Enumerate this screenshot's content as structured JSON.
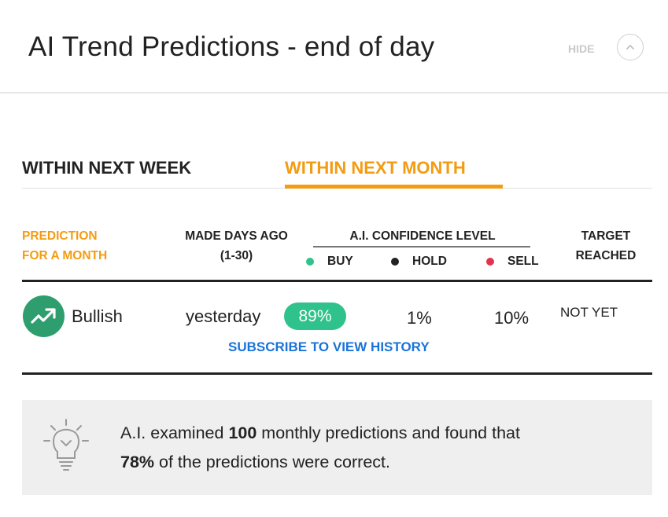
{
  "header": {
    "title": "AI Trend Predictions - end of day",
    "hide_label": "HIDE",
    "collapse_icon": "chevron-up-icon"
  },
  "tabs": [
    {
      "label": "WITHIN NEXT WEEK",
      "active": false
    },
    {
      "label": "WITHIN NEXT MONTH",
      "active": true
    }
  ],
  "table": {
    "headers": {
      "prediction_line1": "PREDICTION",
      "prediction_line2": "FOR A MONTH",
      "made_line1": "MADE DAYS AGO",
      "made_line2": "(1-30)",
      "confidence": "A.I. CONFIDENCE LEVEL",
      "target_line1": "TARGET",
      "target_line2": "REACHED"
    },
    "legend": [
      {
        "label": "BUY",
        "color": "#2fc28c"
      },
      {
        "label": "HOLD",
        "color": "#222222"
      },
      {
        "label": "SELL",
        "color": "#e0354e"
      }
    ],
    "row": {
      "prediction": "Bullish",
      "trend_icon": "trend-up-icon",
      "made": "yesterday",
      "buy": "89%",
      "hold": "1%",
      "sell": "10%",
      "target": "NOT YET"
    },
    "subscribe_label": "SUBSCRIBE TO VIEW HISTORY"
  },
  "info": {
    "icon": "lightbulb-icon",
    "text_1": "A.I. examined ",
    "count": "100",
    "text_2": " monthly predictions and found that",
    "percent": "78%",
    "text_3": " of the predictions were correct."
  },
  "colors": {
    "accent": "#f39c12",
    "buy": "#2fc28c",
    "sell": "#e0354e",
    "link": "#1a73d9"
  }
}
